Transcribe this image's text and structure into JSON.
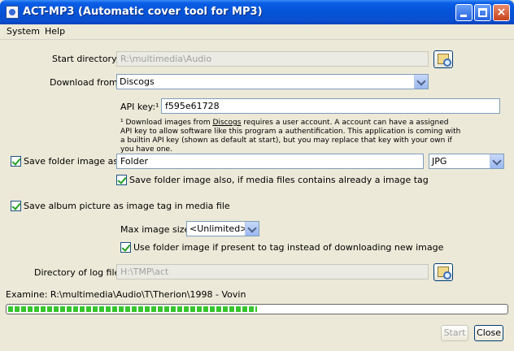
{
  "window": {
    "title": "ACT-MP3 (Automatic cover tool for MP3)"
  },
  "menu": {
    "items": [
      "System",
      "Help"
    ]
  },
  "form": {
    "start_directory": {
      "label": "Start directory:",
      "value": "R:\\multimedia\\Audio"
    },
    "download_from": {
      "label": "Download from:",
      "value": "Discogs"
    },
    "api_key": {
      "label": "API key:¹",
      "value": "f595e61728"
    },
    "note": {
      "prefix": "¹ Download images from ",
      "link": "Discogs",
      "rest": " requires a user account. A account can have a assigned API key to allow software like this program a authentification. This application is coming with a builtin API key (shown as default at start), but you may replace that key with your own if you have one."
    },
    "save_folder_image": {
      "label": "Save folder image as:",
      "checked": true,
      "name": "Folder",
      "format": "JPG"
    },
    "save_folder_also": {
      "label": "Save folder image also, if media files contains already a image tag",
      "checked": true
    },
    "save_album_tag": {
      "label": "Save album picture as image tag in media file",
      "checked": true
    },
    "max_image_size": {
      "label": "Max image size:",
      "value": "<Unlimited>"
    },
    "use_folder_image": {
      "label": "Use folder image if present to tag instead of downloading new image",
      "checked": true
    },
    "log_directory": {
      "label": "Directory of log file:",
      "value": "H:\\TMP\\act"
    }
  },
  "status": {
    "examine": "Examine: R:\\multimedia\\Audio\\T\\Therion\\1998 - Vovin",
    "progress": 0.5
  },
  "buttons": {
    "start": "Start",
    "close": "Close"
  },
  "colors": {
    "titlebar": "#0553d6",
    "progress": "#37c52e"
  }
}
